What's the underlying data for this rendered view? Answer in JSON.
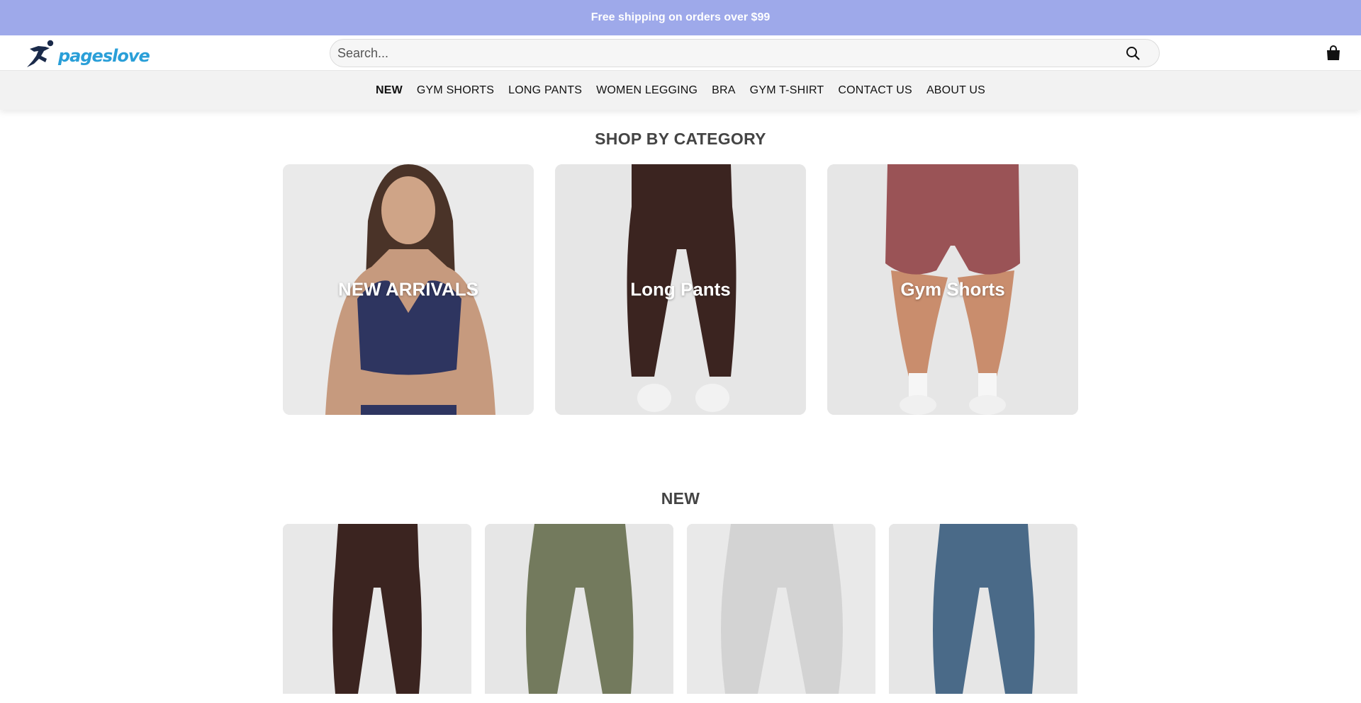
{
  "announcement": {
    "text": "Free shipping on orders over $99"
  },
  "header": {
    "logo_text": "pageslove",
    "search_placeholder": "Search...",
    "icons": {
      "search": "search-icon",
      "cart": "shopping-bag-icon"
    }
  },
  "nav": {
    "items": [
      {
        "label": "NEW",
        "active": true
      },
      {
        "label": "GYM SHORTS"
      },
      {
        "label": "LONG PANTS"
      },
      {
        "label": "WOMEN LEGGING"
      },
      {
        "label": "BRA"
      },
      {
        "label": "GYM T-SHIRT"
      },
      {
        "label": "CONTACT US"
      },
      {
        "label": "ABOUT US"
      }
    ]
  },
  "shop_by_category": {
    "title": "SHOP BY CATEGORY",
    "categories": [
      {
        "label": "NEW ARRIVALS"
      },
      {
        "label": "Long Pants"
      },
      {
        "label": "Gym Shorts"
      }
    ]
  },
  "new_section": {
    "title": "NEW",
    "products": [
      {
        "color": "#3b2420"
      },
      {
        "color": "#737a5d"
      },
      {
        "color": "#d3d3d3"
      },
      {
        "color": "#4a6a88"
      }
    ]
  },
  "colors": {
    "announcement_bg": "#9ea9ea",
    "logo_blue": "#2a9fd8",
    "nav_bg": "#f2f2f2"
  }
}
